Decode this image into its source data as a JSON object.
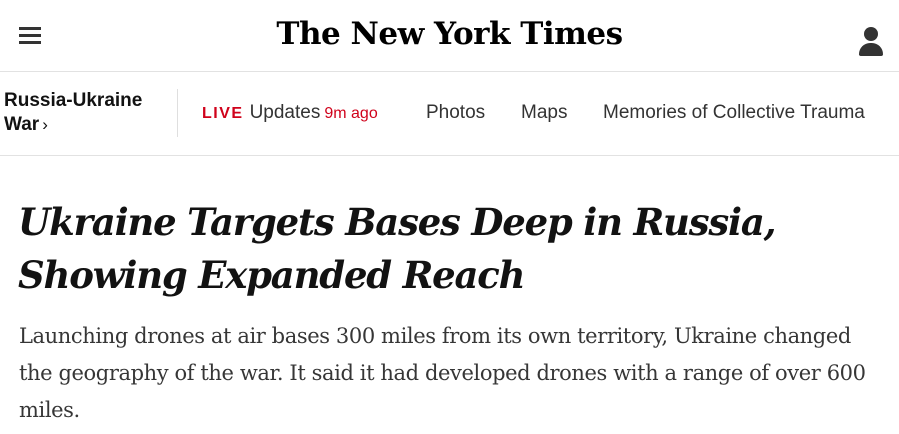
{
  "masthead": {
    "logo_text": "The New York Times",
    "menu_icon": "hamburger-menu-icon",
    "account_icon": "user-account-icon"
  },
  "nav": {
    "section_label_line1": "Russia-Ukraine",
    "section_label_line2": "War",
    "section_chevron": "›",
    "live_label": "LIVE",
    "live_text": "Updates",
    "live_time": "9m ago",
    "items": [
      {
        "label": "Photos"
      },
      {
        "label": "Maps"
      },
      {
        "label": "Memories of Collective Trauma"
      }
    ]
  },
  "article": {
    "headline": "Ukraine Targets Bases Deep in Russia, Showing Expanded Reach",
    "summary": "Launching drones at air bases 300 miles from its own territory, Ukraine changed the geography of the war. It said it had developed drones with a range of over 600 miles."
  },
  "colors": {
    "live_red": "#d0021b",
    "text": "#121212",
    "divider": "#e2e2e2"
  }
}
